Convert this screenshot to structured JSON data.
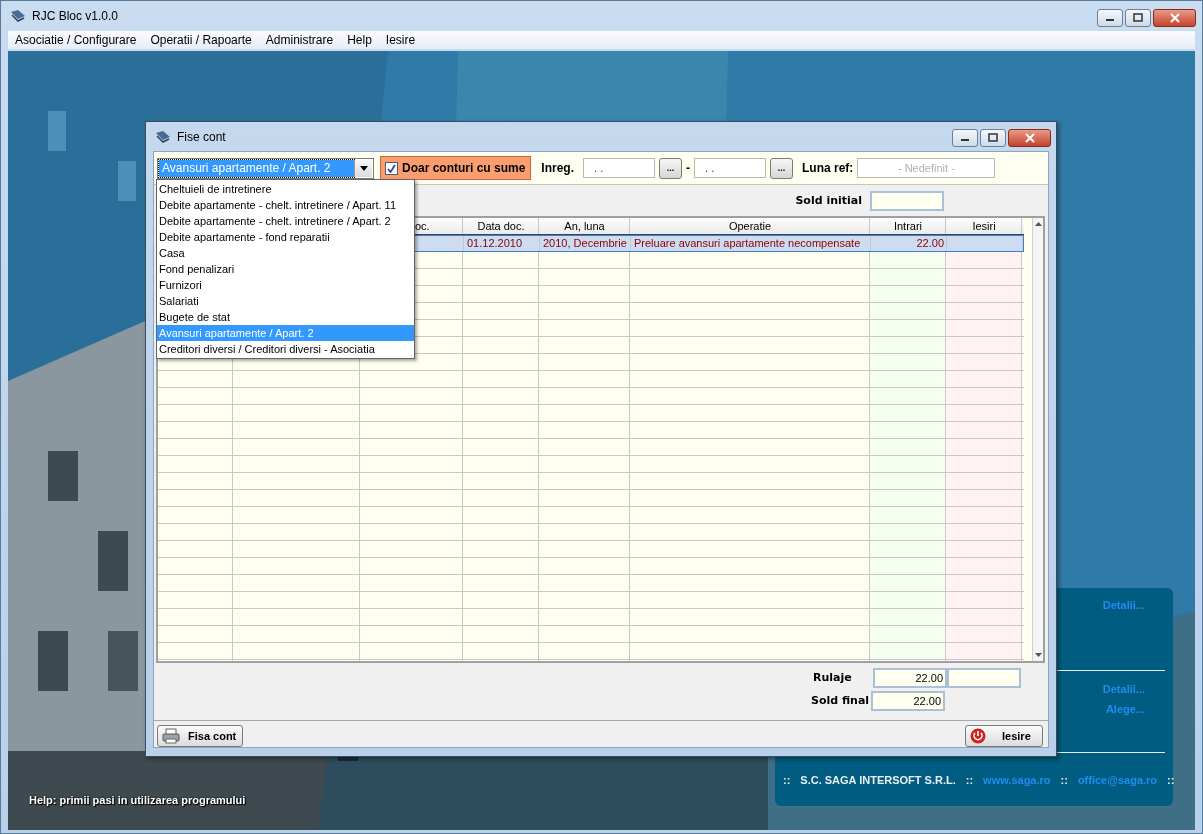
{
  "window": {
    "title": "RJC Bloc v1.0.0"
  },
  "menu": [
    {
      "label": "Asociatie / Configurare"
    },
    {
      "label": "Operatii / Rapoarte"
    },
    {
      "label": "Administrare"
    },
    {
      "label": "Help"
    },
    {
      "label": "Iesire"
    }
  ],
  "info_panel": {
    "links": [
      "Detalii...",
      "Detalii...",
      "Alege..."
    ],
    "footer": [
      {
        "kind": "separator",
        "text": "::"
      },
      {
        "kind": "text",
        "text": "S.C. SAGA INTERSOFT S.R.L."
      },
      {
        "kind": "separator",
        "text": "::"
      },
      {
        "kind": "link",
        "text": "www.saga.ro"
      },
      {
        "kind": "separator",
        "text": "::"
      },
      {
        "kind": "link",
        "text": "office@saga.ro"
      },
      {
        "kind": "separator",
        "text": "::"
      }
    ]
  },
  "help_text": "Help: primii pasi in utilizarea programului",
  "dialog": {
    "title": "Fise cont",
    "account_select": {
      "value": "Avansuri apartamente / Apart. 2",
      "expanded": true,
      "options": [
        {
          "label": "Cheltuieli de intretinere",
          "selected": false
        },
        {
          "label": "Debite apartamente - chelt. intretinere / Apart. 11",
          "selected": false
        },
        {
          "label": "Debite apartamente - chelt. intretinere / Apart. 2",
          "selected": false
        },
        {
          "label": "Debite apartamente - fond reparatii",
          "selected": false
        },
        {
          "label": "Casa",
          "selected": false
        },
        {
          "label": "Fond penalizari",
          "selected": false
        },
        {
          "label": "Furnizori",
          "selected": false
        },
        {
          "label": "Salariati",
          "selected": false
        },
        {
          "label": "Bugete de stat",
          "selected": false
        },
        {
          "label": "Avansuri apartamente / Apart. 2",
          "selected": true
        },
        {
          "label": "Creditori diversi / Creditori diversi - Asociatia",
          "selected": false
        }
      ]
    },
    "only_with_sums": {
      "label": "Doar conturi cu sume",
      "checked": true
    },
    "inreg": {
      "label": "Inreg.",
      "from": ". .",
      "browse": "...",
      "separator": "-",
      "to": ". ."
    },
    "luna_ref": {
      "label": "Luna ref:",
      "placeholder": "- Nedefinit -"
    },
    "sold_initial": {
      "label": "Sold initial"
    },
    "table": {
      "columns": [
        {
          "label": "oc."
        },
        {
          "label": "Data doc."
        },
        {
          "label": "An, luna"
        },
        {
          "label": "Operatie"
        },
        {
          "label": "Intrari"
        },
        {
          "label": "Iesiri"
        }
      ],
      "rows": [
        {
          "selected": true,
          "cells": [
            null,
            "01.12.2010",
            "2010, Decembrie",
            "Preluare avansuri apartamente necompensate",
            "22.00",
            null
          ]
        }
      ]
    },
    "rulaje": {
      "label": "Rulaje",
      "intrari": "22.00"
    },
    "sold_final": {
      "label": "Sold final",
      "intrari": "22.00"
    },
    "buttons": [
      {
        "kind": "print",
        "label": "Fisa cont"
      },
      {
        "kind": "exit",
        "label": "Iesire"
      }
    ]
  }
}
